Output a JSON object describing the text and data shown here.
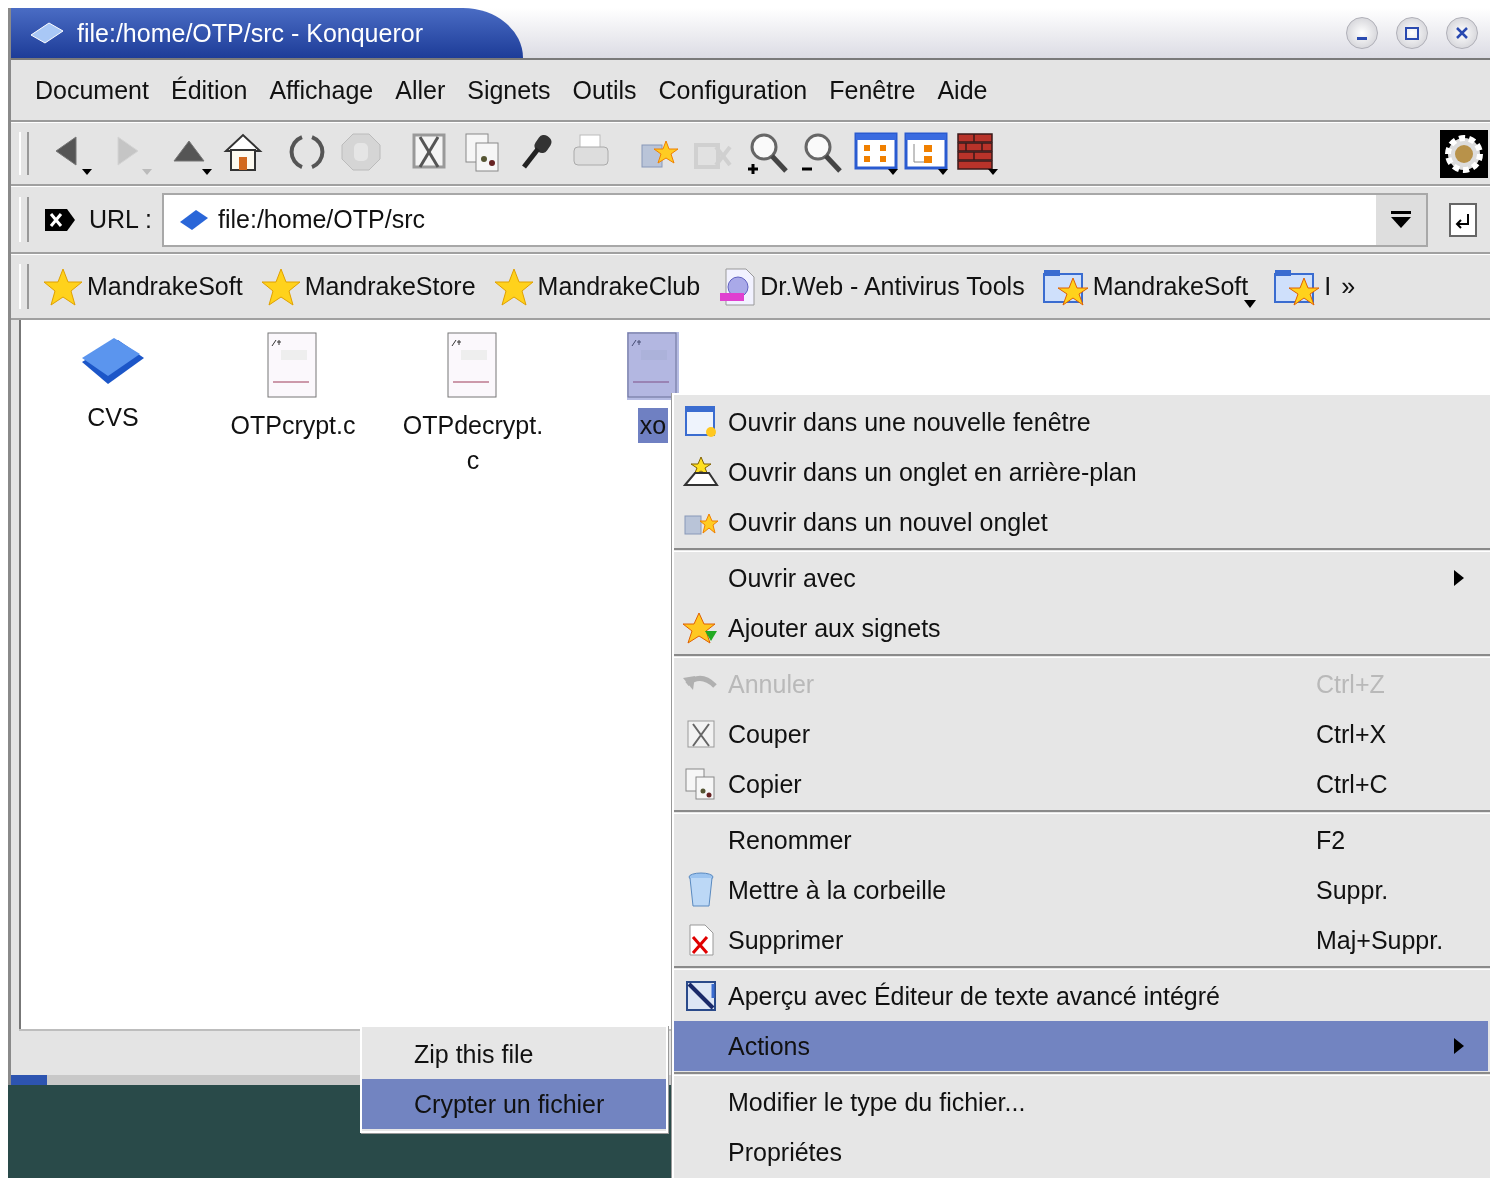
{
  "window": {
    "title": "file:/home/OTP/src - Konqueror"
  },
  "menubar": [
    "Document",
    "Édition",
    "Affichage",
    "Aller",
    "Signets",
    "Outils",
    "Configuration",
    "Fenêtre",
    "Aide"
  ],
  "toolbar": [
    {
      "kind": "back",
      "disabled": false,
      "dropdown": true
    },
    {
      "kind": "forward",
      "disabled": true,
      "dropdown": true
    },
    {
      "kind": "up",
      "disabled": false,
      "dropdown": true
    },
    {
      "kind": "home",
      "disabled": false,
      "dropdown": false
    },
    {
      "kind": "reload",
      "disabled": false,
      "dropdown": false
    },
    {
      "kind": "stop",
      "disabled": true,
      "dropdown": false
    },
    {
      "kind": "cut",
      "disabled": false,
      "dropdown": false
    },
    {
      "kind": "copy",
      "disabled": false,
      "dropdown": false
    },
    {
      "kind": "paste",
      "disabled": false,
      "dropdown": false
    },
    {
      "kind": "print",
      "disabled": false,
      "dropdown": false
    },
    {
      "kind": "new-tab",
      "disabled": false,
      "dropdown": false
    },
    {
      "kind": "close-tab",
      "disabled": true,
      "dropdown": false
    },
    {
      "kind": "zoom-in",
      "disabled": false,
      "dropdown": false
    },
    {
      "kind": "zoom-out",
      "disabled": false,
      "dropdown": false
    },
    {
      "kind": "icon-view",
      "disabled": false,
      "dropdown": true
    },
    {
      "kind": "tree-view",
      "disabled": false,
      "dropdown": true
    },
    {
      "kind": "firewall",
      "disabled": false,
      "dropdown": true
    }
  ],
  "url_bar": {
    "label": "URL :",
    "value": "file:/home/OTP/src"
  },
  "bookmarks": {
    "items": [
      {
        "label": "MandrakeSoft",
        "kind": "bookmark",
        "dropdown": false
      },
      {
        "label": "MandrakeStore",
        "kind": "bookmark",
        "dropdown": false
      },
      {
        "label": "MandrakeClub",
        "kind": "bookmark",
        "dropdown": false
      },
      {
        "label": "Dr.Web - Antivirus Tools",
        "kind": "page",
        "dropdown": false
      },
      {
        "label": "MandrakeSoft",
        "kind": "folder",
        "dropdown": true
      },
      {
        "label": "I",
        "kind": "folder",
        "dropdown": false
      }
    ],
    "overflow": "»"
  },
  "files": [
    {
      "name": "CVS",
      "kind": "folder",
      "selected": false
    },
    {
      "name": "OTPcrypt.c",
      "kind": "source",
      "selected": false
    },
    {
      "name": "OTPdecrypt.c",
      "kind": "source",
      "selected": false
    },
    {
      "name": "xo",
      "kind": "source",
      "selected": true
    }
  ],
  "context_menu": {
    "sections": [
      [
        {
          "label": "Ouvrir dans une nouvelle fenêtre",
          "disabled": false,
          "submenu": false,
          "selected": false
        },
        {
          "label": "Ouvrir dans un onglet en arrière-plan",
          "disabled": false,
          "submenu": false,
          "selected": false
        },
        {
          "label": "Ouvrir dans un nouvel onglet",
          "disabled": false,
          "submenu": false,
          "selected": false
        }
      ],
      [
        {
          "label": "Ouvrir avec",
          "disabled": false,
          "submenu": true,
          "selected": false
        },
        {
          "label": "Ajouter aux signets",
          "disabled": false,
          "submenu": false,
          "selected": false
        }
      ],
      [
        {
          "label": "Annuler",
          "shortcut": "Ctrl+Z",
          "disabled": true,
          "submenu": false,
          "selected": false
        },
        {
          "label": "Couper",
          "shortcut": "Ctrl+X",
          "disabled": false,
          "submenu": false,
          "selected": false
        },
        {
          "label": "Copier",
          "shortcut": "Ctrl+C",
          "disabled": false,
          "submenu": false,
          "selected": false
        }
      ],
      [
        {
          "label": "Renommer",
          "shortcut": "F2",
          "disabled": false,
          "submenu": false,
          "selected": false
        },
        {
          "label": "Mettre à la corbeille",
          "shortcut": "Suppr.",
          "disabled": false,
          "submenu": false,
          "selected": false
        },
        {
          "label": "Supprimer",
          "shortcut": "Maj+Suppr.",
          "disabled": false,
          "submenu": false,
          "selected": false
        }
      ],
      [
        {
          "label": "Aperçu avec Éditeur de texte avancé intégré",
          "disabled": false,
          "submenu": false,
          "selected": false
        },
        {
          "label": "Actions",
          "disabled": false,
          "submenu": true,
          "selected": true
        }
      ],
      [
        {
          "label": "Modifier le type du fichier...",
          "disabled": false,
          "submenu": false,
          "selected": false
        },
        {
          "label": "Propriétes",
          "disabled": false,
          "submenu": false,
          "selected": false
        }
      ]
    ]
  },
  "submenu": {
    "items": [
      {
        "label": "Zip this file",
        "selected": false
      },
      {
        "label": "Crypter un fichier",
        "selected": true
      }
    ]
  }
}
